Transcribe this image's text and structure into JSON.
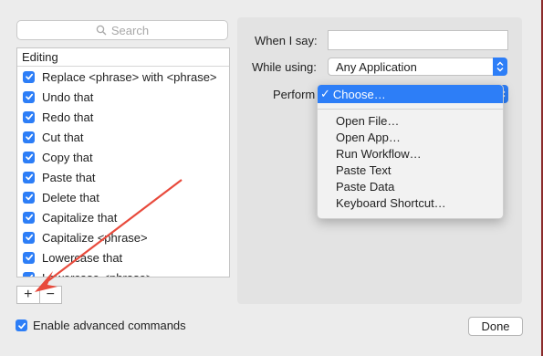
{
  "search": {
    "placeholder": "Search"
  },
  "list": {
    "header": "Editing",
    "items": [
      {
        "label": "Replace <phrase> with <phrase>",
        "checked": true
      },
      {
        "label": "Undo that",
        "checked": true
      },
      {
        "label": "Redo that",
        "checked": true
      },
      {
        "label": "Cut that",
        "checked": true
      },
      {
        "label": "Copy that",
        "checked": true
      },
      {
        "label": "Paste that",
        "checked": true
      },
      {
        "label": "Delete that",
        "checked": true
      },
      {
        "label": "Capitalize that",
        "checked": true
      },
      {
        "label": "Capitalize <phrase>",
        "checked": true
      },
      {
        "label": "Lowercase that",
        "checked": true
      },
      {
        "label": "Lowercase <phrase>",
        "checked": true
      }
    ]
  },
  "buttons": {
    "add": "+",
    "remove": "−",
    "done": "Done"
  },
  "advanced": {
    "label": "Enable advanced commands",
    "checked": true
  },
  "form": {
    "when_label": "When I say:",
    "when_value": "",
    "while_label": "While using:",
    "while_value": "Any Application",
    "perform_label": "Perform"
  },
  "menu": {
    "selected": "Choose…",
    "checkmark": "✓",
    "items": [
      "Open File…",
      "Open App…",
      "Run Workflow…",
      "Paste Text",
      "Paste Data",
      "Keyboard Shortcut…"
    ]
  },
  "colors": {
    "accent": "#2d7ef7",
    "annotation_arrow": "#e84a3c"
  }
}
